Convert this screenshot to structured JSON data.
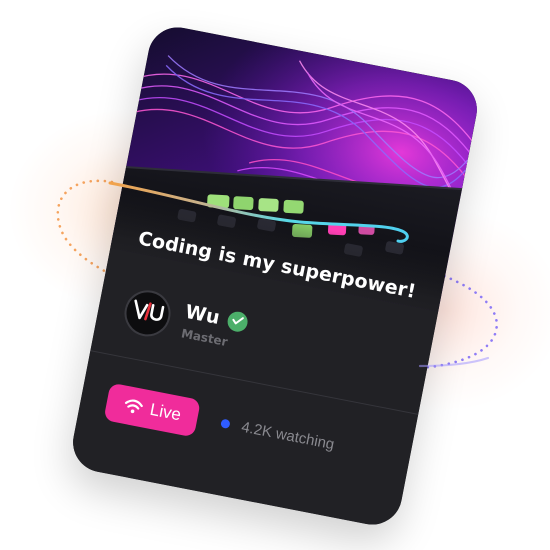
{
  "card": {
    "title": "Coding is my superpower!",
    "author": {
      "name": "Wu",
      "role": "Master",
      "avatar_icon": "vu-logo-icon",
      "verified_icon": "check-icon"
    },
    "live_button": {
      "label": "Live",
      "icon": "wifi-icon"
    },
    "viewers": {
      "text": "4.2K watching"
    }
  },
  "colors": {
    "card_bg": "#212125",
    "live_pink": "#f02c9b",
    "verified_green": "#4caf6a",
    "viewer_dot_blue": "#2f5cff",
    "orbit_orange": "#f4a04a",
    "orbit_cyan": "#4fd8e8",
    "orbit_purple": "#8a70ff"
  }
}
